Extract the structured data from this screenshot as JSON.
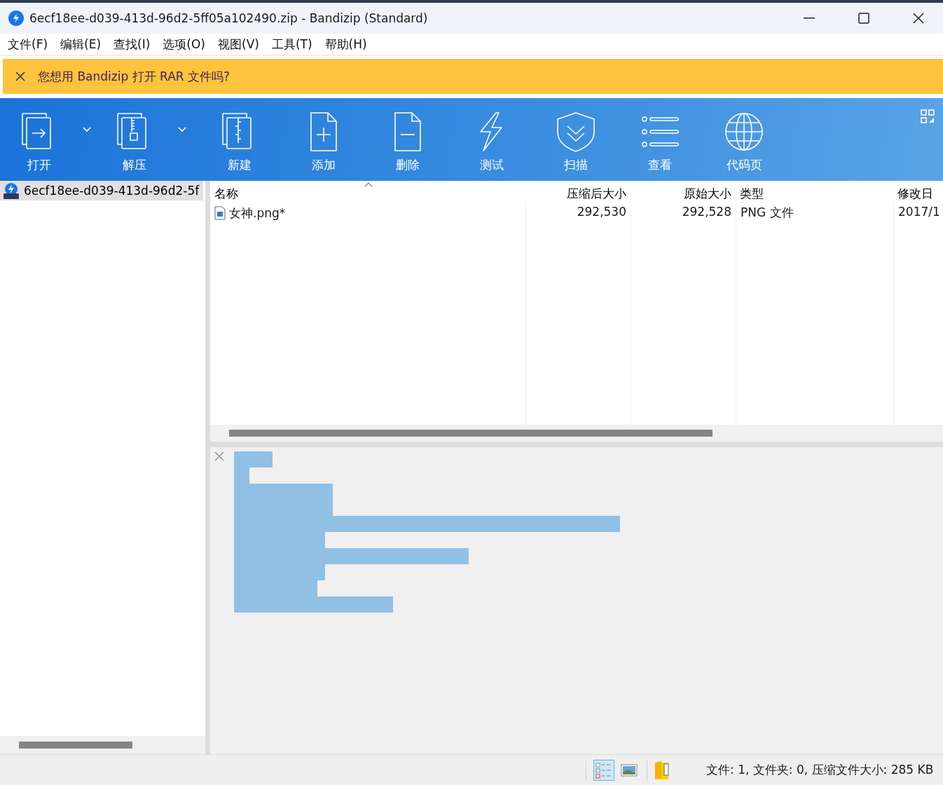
{
  "window": {
    "title": "6ecf18ee-d039-413d-96d2-5ff05a102490.zip - Bandizip (Standard)"
  },
  "menu": [
    "文件(F)",
    "编辑(E)",
    "查找(I)",
    "选项(O)",
    "视图(V)",
    "工具(T)",
    "帮助(H)"
  ],
  "notice": {
    "text": "您想用 Bandizip 打开 RAR 文件吗?"
  },
  "toolbar": [
    {
      "label": "打开",
      "kind": "open",
      "dropdown": true
    },
    {
      "label": "解压",
      "kind": "extract",
      "dropdown": true
    },
    {
      "label": "新建",
      "kind": "new",
      "dropdown": false
    },
    {
      "label": "添加",
      "kind": "add",
      "dropdown": false
    },
    {
      "label": "删除",
      "kind": "delete",
      "dropdown": false
    },
    {
      "label": "测试",
      "kind": "test",
      "dropdown": false
    },
    {
      "label": "扫描",
      "kind": "scan",
      "dropdown": false
    },
    {
      "label": "查看",
      "kind": "view",
      "dropdown": false
    },
    {
      "label": "代码页",
      "kind": "codepage",
      "dropdown": false
    }
  ],
  "tree": [
    {
      "label": "6ecf18ee-d039-413d-96d2-5f",
      "selected": true
    }
  ],
  "table": {
    "columns": [
      {
        "label": "名称",
        "kind": "text"
      },
      {
        "label": "压缩后大小",
        "kind": "number"
      },
      {
        "label": "原始大小",
        "kind": "number"
      },
      {
        "label": "类型",
        "kind": "text"
      },
      {
        "label": "修改日",
        "kind": "text"
      }
    ],
    "rows": [
      {
        "cells": [
          "女神.png*",
          "292,530",
          "292,528",
          "PNG 文件",
          "2017/1"
        ],
        "selected": false
      }
    ]
  },
  "status_bar": {
    "views": [
      {
        "kind": "details",
        "selected": true
      },
      {
        "kind": "thumbnail",
        "selected": false
      }
    ],
    "text": "文件: 1, 文件夹: 0, 压缩文件大小: 285 KB"
  }
}
